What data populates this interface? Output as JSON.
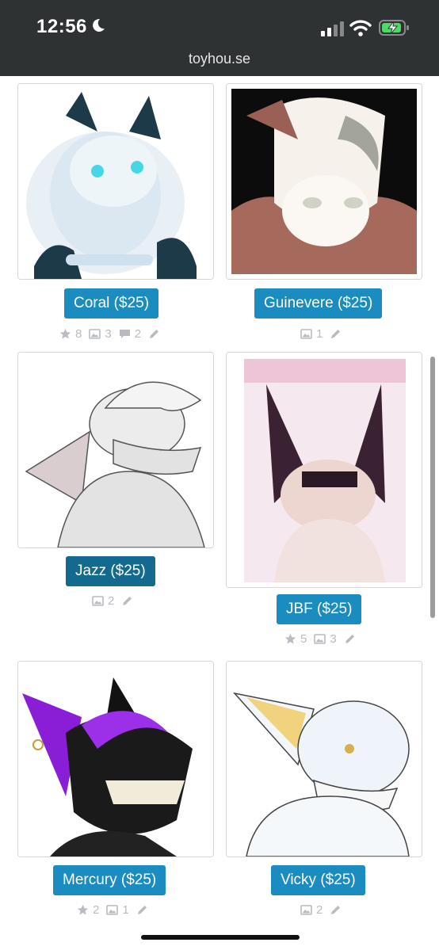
{
  "status_bar": {
    "time": "12:56",
    "url": "toyhou.se"
  },
  "characters": [
    {
      "name": "Coral ($25)",
      "favorites": "8",
      "images": "3",
      "comments": "2"
    },
    {
      "name": "Guinevere ($25)",
      "images": "1"
    },
    {
      "name": "Jazz ($25)",
      "images": "2"
    },
    {
      "name": "JBF ($25)",
      "favorites": "5",
      "images": "3"
    },
    {
      "name": "Mercury ($25)",
      "favorites": "2",
      "images": "1"
    },
    {
      "name": "Vicky ($25)",
      "images": "2"
    }
  ],
  "colors": {
    "status_bar_bg": "#2e3233",
    "button": "#1b8cc0",
    "button_active": "#136a8f",
    "stat_text": "#b8bcc0"
  }
}
